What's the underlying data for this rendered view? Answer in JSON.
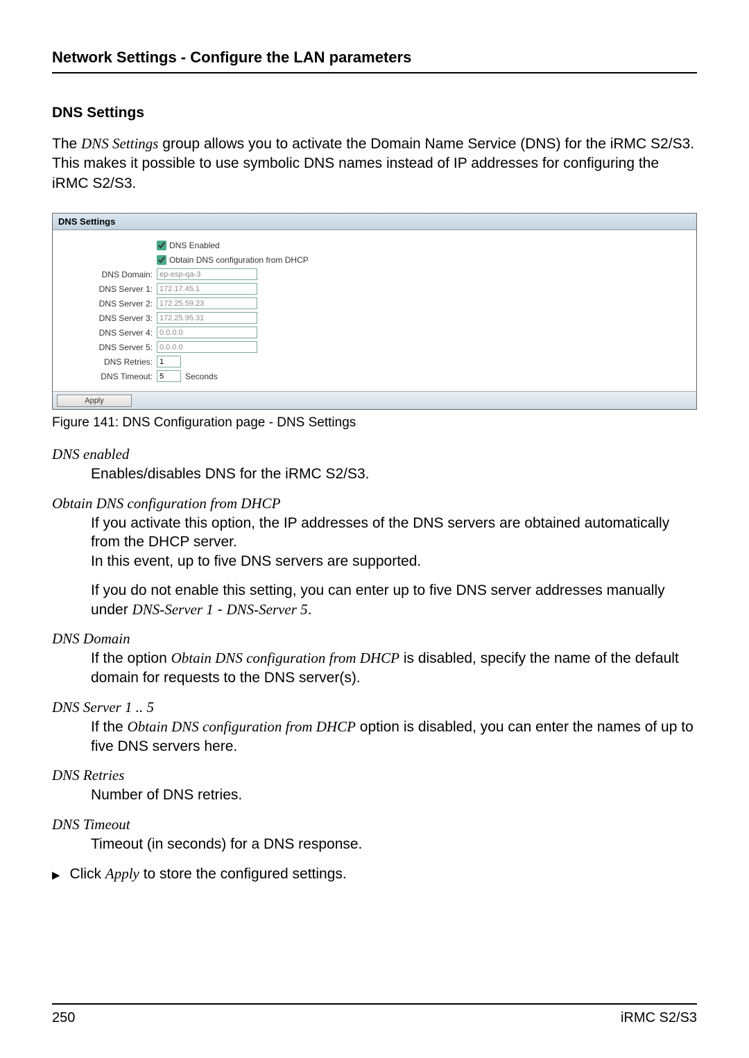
{
  "header": "Network Settings - Configure the LAN parameters",
  "section_title": "DNS Settings",
  "intro": "The DNS Settings group allows you to activate the Domain Name Service (DNS) for the iRMC S2/S3. This makes it possible to use symbolic DNS names instead of IP addresses for configuring the iRMC S2/S3.",
  "intro_italic": "DNS Settings",
  "panel": {
    "title": "DNS Settings",
    "dns_enabled_label": "DNS Enabled",
    "obtain_label": "Obtain DNS configuration from DHCP",
    "rows": {
      "dns_domain_label": "DNS Domain:",
      "dns_domain_value": "ep-esp-qa-3",
      "dns_server1_label": "DNS Server 1:",
      "dns_server1_value": "172.17.45.1",
      "dns_server2_label": "DNS Server 2:",
      "dns_server2_value": "172.25.59.23",
      "dns_server3_label": "DNS Server 3:",
      "dns_server3_value": "172.25.95.31",
      "dns_server4_label": "DNS Server 4:",
      "dns_server4_value": "0.0.0.0",
      "dns_server5_label": "DNS Server 5:",
      "dns_server5_value": "0.0.0.0",
      "dns_retries_label": "DNS Retries:",
      "dns_retries_value": "1",
      "dns_timeout_label": "DNS Timeout:",
      "dns_timeout_value": "5",
      "seconds": "Seconds"
    },
    "apply": "Apply"
  },
  "caption": "Figure 141: DNS Configuration page - DNS Settings",
  "defs": {
    "dns_enabled": {
      "term": "DNS enabled",
      "body": "Enables/disables DNS for the iRMC S2/S3."
    },
    "obtain": {
      "term": "Obtain DNS configuration from DHCP",
      "p1a": "If you activate this option, the IP addresses of the DNS servers are obtained automatically from the DHCP server.",
      "p1b": "In this event, up to five DNS servers are supported.",
      "p2a": "If you do not enable this setting, you can enter up to five DNS server addresses manually under ",
      "p2b": "DNS-Server 1",
      "p2c": " - ",
      "p2d": "DNS-Server 5",
      "p2e": "."
    },
    "domain": {
      "term": "DNS Domain",
      "pre": "If the option ",
      "it": "Obtain DNS configuration from DHCP",
      "post": " is disabled, specify the name of the default domain for requests to the DNS server(s)."
    },
    "server": {
      "term": "DNS Server 1 .. 5",
      "pre": "If the ",
      "it": "Obtain DNS configuration from DHCP",
      "post": " option is disabled, you can enter the names of up to five DNS servers here."
    },
    "retries": {
      "term": "DNS Retries",
      "body": "Number of DNS retries."
    },
    "timeout": {
      "term": "DNS Timeout",
      "body": "Timeout (in seconds) for a DNS response."
    }
  },
  "action": {
    "pre": "Click ",
    "it": "Apply",
    "post": " to store the configured settings."
  },
  "footer": {
    "page": "250",
    "product": "iRMC S2/S3"
  }
}
